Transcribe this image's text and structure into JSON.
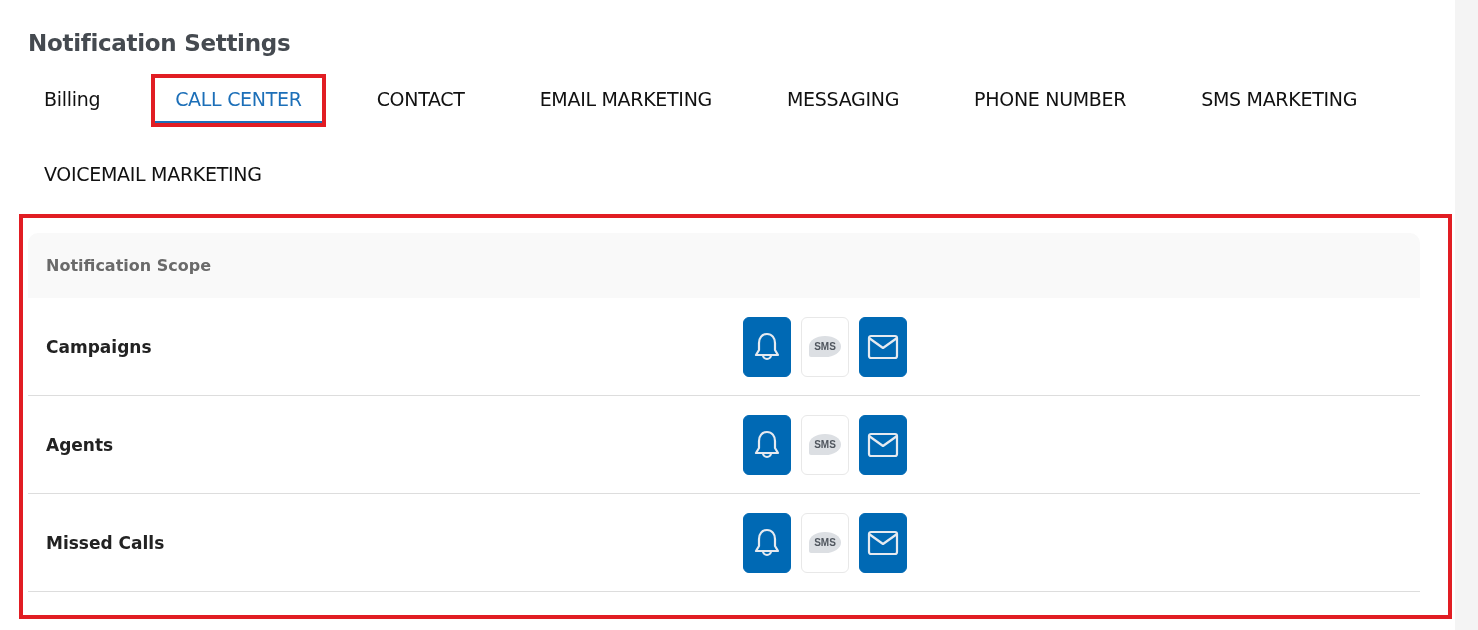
{
  "title": "Notification Settings",
  "tabs": [
    {
      "label": "Billing",
      "selected": false,
      "highlighted": false
    },
    {
      "label": "CALL CENTER",
      "selected": true,
      "highlighted": true
    },
    {
      "label": "CONTACT",
      "selected": false,
      "highlighted": false
    },
    {
      "label": "EMAIL MARKETING",
      "selected": false,
      "highlighted": false
    },
    {
      "label": "MESSAGING",
      "selected": false,
      "highlighted": false
    },
    {
      "label": "PHONE NUMBER",
      "selected": false,
      "highlighted": false
    },
    {
      "label": "SMS MARKETING",
      "selected": false,
      "highlighted": false
    },
    {
      "label": "VOICEMAIL MARKETING",
      "selected": false,
      "highlighted": false
    }
  ],
  "table": {
    "highlighted": true,
    "header": "Notification Scope",
    "rows": [
      {
        "name": "Campaigns",
        "channels": [
          {
            "kind": "bell",
            "on": true
          },
          {
            "kind": "sms",
            "on": false,
            "label": "SMS"
          },
          {
            "kind": "email",
            "on": true
          }
        ]
      },
      {
        "name": "Agents",
        "channels": [
          {
            "kind": "bell",
            "on": true
          },
          {
            "kind": "sms",
            "on": false,
            "label": "SMS"
          },
          {
            "kind": "email",
            "on": true
          }
        ]
      },
      {
        "name": "Missed Calls",
        "channels": [
          {
            "kind": "bell",
            "on": true
          },
          {
            "kind": "sms",
            "on": false,
            "label": "SMS"
          },
          {
            "kind": "email",
            "on": true
          }
        ]
      }
    ]
  }
}
